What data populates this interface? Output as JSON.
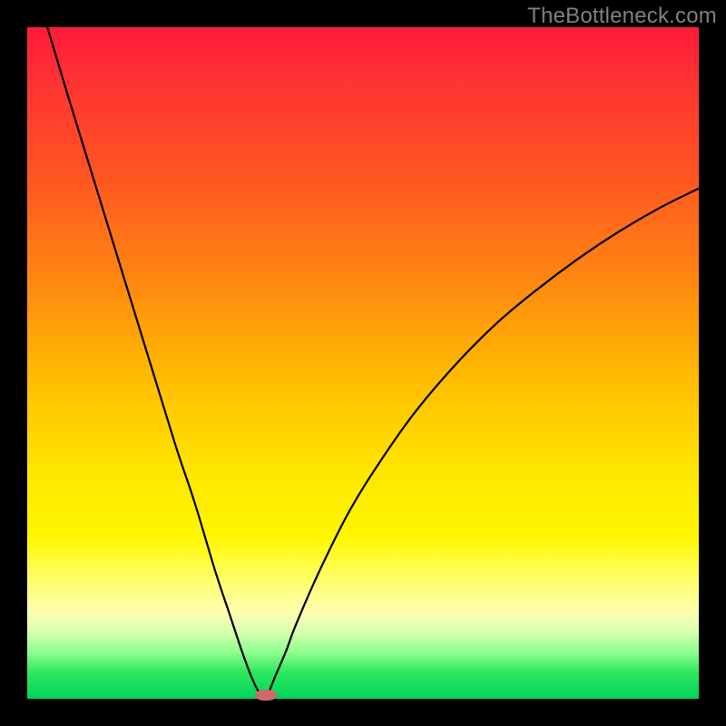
{
  "watermark": "TheBottleneck.com",
  "chart_data": {
    "type": "line",
    "title": "",
    "xlabel": "",
    "ylabel": "",
    "xlim": [
      0,
      100
    ],
    "ylim": [
      0,
      100
    ],
    "grid": false,
    "legend": false,
    "series": [
      {
        "name": "bottleneck-curve-left",
        "x": [
          3,
          6,
          10,
          14,
          18,
          22,
          25,
          28,
          30,
          32,
          33.5,
          34.5,
          35.2,
          35.5
        ],
        "y": [
          100,
          90,
          77,
          64,
          51,
          38,
          29,
          19,
          13,
          7,
          3,
          1,
          0.3,
          0
        ]
      },
      {
        "name": "bottleneck-curve-right",
        "x": [
          35.5,
          36,
          37,
          38.5,
          40,
          43.5,
          48,
          53,
          58,
          64,
          70,
          76,
          82,
          88,
          94,
          100
        ],
        "y": [
          0,
          1,
          3.5,
          7,
          11,
          19,
          28,
          36,
          43,
          50,
          56,
          61,
          65.5,
          69.5,
          73,
          76
        ]
      }
    ],
    "annotations": [
      {
        "name": "optimal-marker",
        "shape": "ellipse",
        "x": 35.5,
        "y": 0.5,
        "color": "#d06a6a"
      }
    ],
    "colors": {
      "curve": "#000000",
      "background_top": "#ff1a3a",
      "background_bottom": "#00d45a",
      "frame": "#000000",
      "marker": "#d06a6a",
      "watermark": "#808080"
    }
  }
}
